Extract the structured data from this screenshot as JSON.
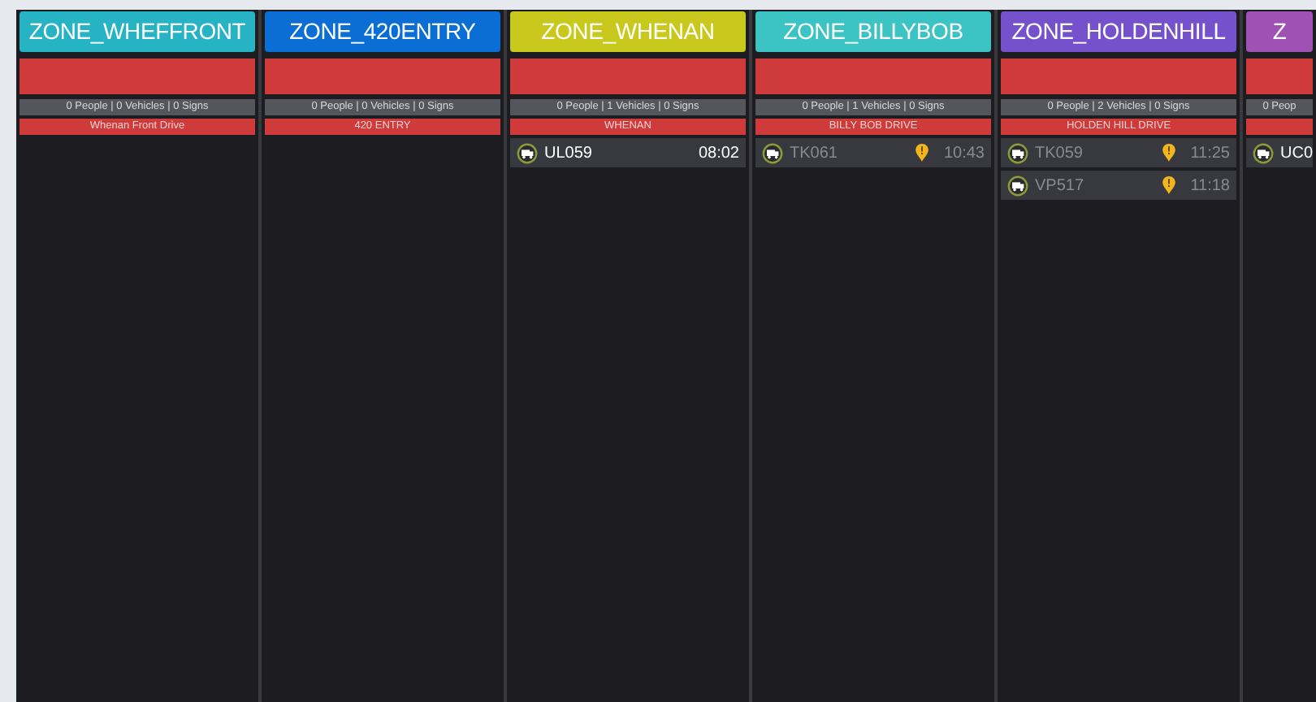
{
  "zones": [
    {
      "title": "ZONE_WHEFFRONT",
      "color": "#26b3c4",
      "stats": "0 People | 0 Vehicles |  0 Signs",
      "location": "Whenan Front Drive"
    },
    {
      "title": "ZONE_420ENTRY",
      "color": "#0a6ed4",
      "stats": "0 People | 0 Vehicles |  0 Signs",
      "location": "420 ENTRY"
    },
    {
      "title": "ZONE_WHENAN",
      "color": "#c9c81c",
      "stats": "0 People | 1 Vehicles |  0 Signs",
      "location": "WHENAN",
      "vehicles": [
        {
          "id": "UL059",
          "time": "08:02",
          "alert": false
        }
      ]
    },
    {
      "title": "ZONE_BILLYBOB",
      "color": "#3cc3c3",
      "stats": "0 People | 1 Vehicles |  0 Signs",
      "location": "BILLY BOB DRIVE",
      "vehicles": [
        {
          "id": "TK061",
          "time": "10:43",
          "alert": true
        }
      ]
    },
    {
      "title": "ZONE_HOLDENHILL",
      "color": "#7552cc",
      "stats": "0 People | 2 Vehicles |  0 Signs",
      "location": "HOLDEN HILL DRIVE",
      "vehicles": [
        {
          "id": "TK059",
          "time": "11:25",
          "alert": true
        },
        {
          "id": "VP517",
          "time": "11:18",
          "alert": true
        }
      ]
    },
    {
      "title": "Z",
      "color": "#a052b4",
      "stats": "0 Peop",
      "vehicles": [
        {
          "id": "UC0",
          "alert": false
        }
      ]
    }
  ]
}
